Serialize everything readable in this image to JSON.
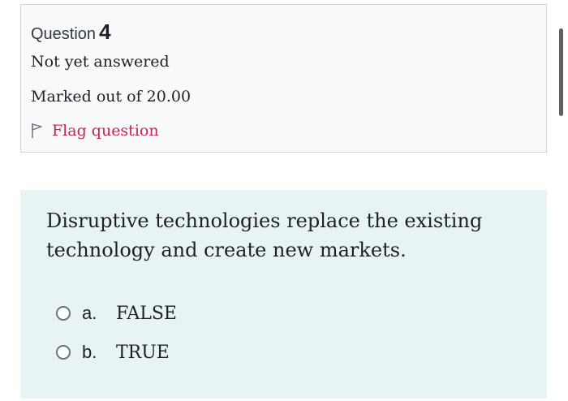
{
  "question": {
    "label": "Question",
    "number": "4",
    "state": "Not yet answered",
    "grade": "Marked out of 20.00",
    "flag_label": "Flag question"
  },
  "content": {
    "text_line1": "Disruptive technologies replace the existing",
    "text_line2": "technology and create new markets.",
    "answers": [
      {
        "letter": "a.",
        "text": "FALSE"
      },
      {
        "letter": "b.",
        "text": "TRUE"
      }
    ]
  },
  "colors": {
    "flag_text": "#c5254e",
    "content_bg": "#e7f3f5",
    "info_bg": "#f8f9fa"
  },
  "icons": {
    "flag": "flag-icon",
    "radio": "radio-icon"
  }
}
